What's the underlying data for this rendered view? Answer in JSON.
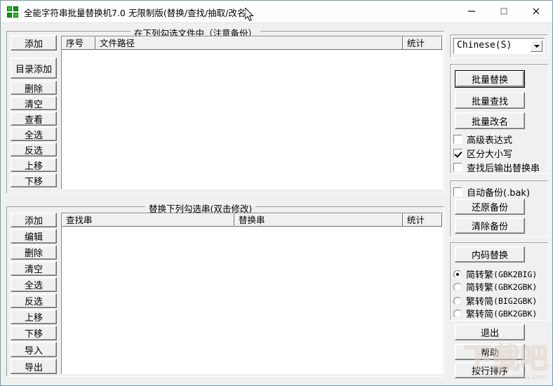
{
  "window": {
    "title": "全能字符串批量替换机7.0 无限制版(替换/查找/抽取/改名)",
    "icon": "app-clover-icon",
    "controls": {
      "minimize": "minimize-icon",
      "maximize": "maximize-icon",
      "close": "close-icon"
    }
  },
  "file_group": {
    "title": "在下列勾选文件中（注意备份）",
    "buttons": [
      "添加",
      "目录添加",
      "删除",
      "清空",
      "查看",
      "全选",
      "反选",
      "上移",
      "下移"
    ],
    "columns": [
      "序号",
      "文件路径",
      "统计"
    ],
    "rows": []
  },
  "replace_group": {
    "title": "替换下列勾选串(双击修改)",
    "buttons": [
      "添加",
      "编辑",
      "删除",
      "清空",
      "全选",
      "反选",
      "上移",
      "下移",
      "导入",
      "导出"
    ],
    "columns": [
      "查找串",
      "替换串",
      "统计"
    ],
    "rows": []
  },
  "right_panel": {
    "language": {
      "selected": "Chinese(S)",
      "options": [
        "Chinese(S)"
      ]
    },
    "actions": {
      "batch_replace": "批量替换",
      "batch_find": "批量查找",
      "batch_rename": "批量改名"
    },
    "options": [
      {
        "label": "高级表达式",
        "checked": false
      },
      {
        "label": "区分大小写",
        "checked": true
      },
      {
        "label": "查找后输出替换串",
        "checked": false
      }
    ],
    "backup": {
      "auto_backup": {
        "label": "自动备份(.bak)",
        "checked": false
      },
      "restore": "还原备份",
      "clear": "清除备份"
    },
    "encoding": {
      "button": "内码替换",
      "radios": [
        {
          "cn": "简转繁",
          "code": "(GBK2BIG)",
          "checked": true
        },
        {
          "cn": "简转繁",
          "code": "(GBK2GBK)",
          "checked": false
        },
        {
          "cn": "繁转简",
          "code": "(BIG2GBK)",
          "checked": false
        },
        {
          "cn": "繁转简",
          "code": "(GBK2GBK)",
          "checked": false
        }
      ]
    },
    "footer": {
      "exit": "退出",
      "help": "帮助",
      "sort": "按行排序"
    }
  },
  "watermark": {
    "logo_text": "下载吧",
    "url": "www.xiazaiba.com"
  }
}
